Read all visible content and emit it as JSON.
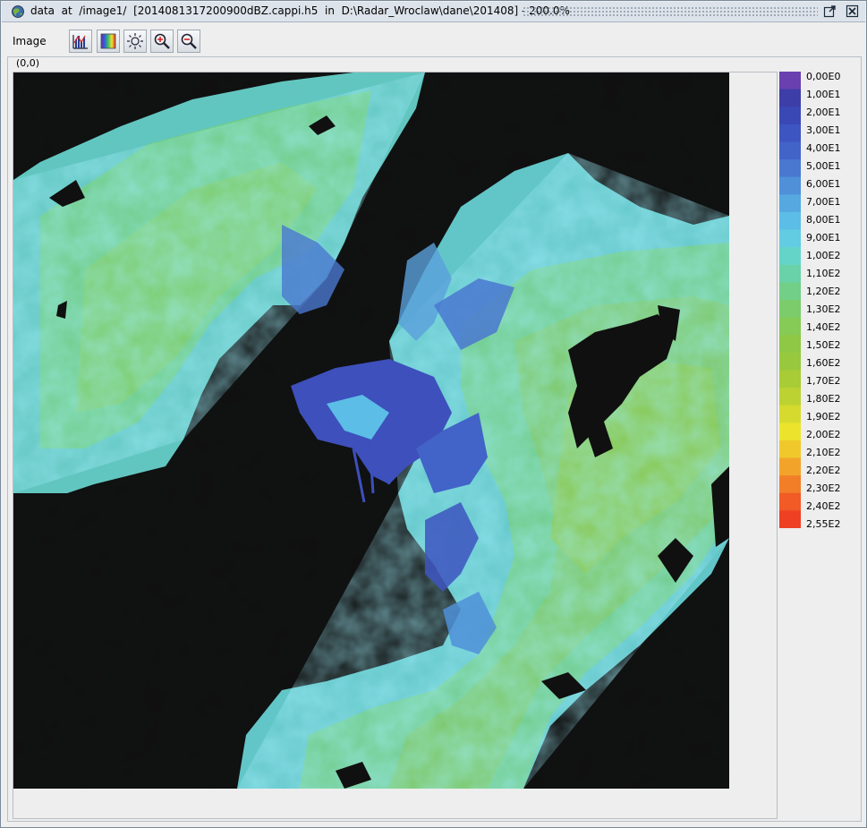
{
  "window": {
    "title": "data  at  /image1/  [2014081317200900dBZ.cappi.h5  in  D:\\Radar_Wroclaw\\dane\\201408] - 200.0%",
    "icons": [
      "globe-icon",
      "undock-icon",
      "close-icon"
    ]
  },
  "menubar": {
    "image_menu": "Image",
    "tools": [
      {
        "name": "histogram-icon"
      },
      {
        "name": "palette-icon"
      },
      {
        "name": "brightness-icon"
      },
      {
        "name": "zoom-in-icon"
      },
      {
        "name": "zoom-out-icon"
      }
    ]
  },
  "viewer": {
    "coordinate": "(0,0)",
    "image_description": "radar reflectivity CAPPI"
  },
  "colorbar": {
    "labels": [
      "0,00E0",
      "1,00E1",
      "2,00E1",
      "3,00E1",
      "4,00E1",
      "5,00E1",
      "6,00E1",
      "7,00E1",
      "8,00E1",
      "9,00E1",
      "1,00E2",
      "1,10E2",
      "1,20E2",
      "1,30E2",
      "1,40E2",
      "1,50E2",
      "1,60E2",
      "1,70E2",
      "1,80E2",
      "1,90E2",
      "2,00E2",
      "2,10E2",
      "2,20E2",
      "2,30E2",
      "2,40E2",
      "2,55E2"
    ],
    "colors": [
      "#6a3fb0",
      "#3d3ea8",
      "#3a48b5",
      "#3d55c0",
      "#4263c8",
      "#4a78d0",
      "#4f90d8",
      "#55a8e0",
      "#5cbde6",
      "#62cce2",
      "#65d4c8",
      "#6ad2a8",
      "#72cf88",
      "#7ccc6c",
      "#86cb55",
      "#8ec845",
      "#98c83e",
      "#a8cc36",
      "#bcd232",
      "#d6da2e",
      "#ece42c",
      "#f0c82c",
      "#f2a42a",
      "#f27e28",
      "#f25a26",
      "#ef4024"
    ]
  }
}
